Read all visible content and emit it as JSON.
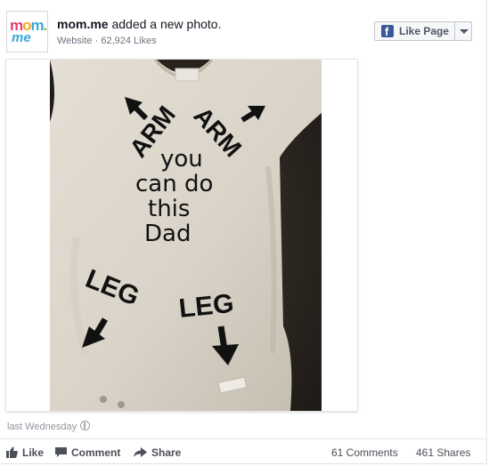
{
  "post": {
    "page_name": "mom.me",
    "action_text": " added a new photo.",
    "category": "Website",
    "likes": "62,924 Likes",
    "timestamp": "last Wednesday"
  },
  "logo": {
    "line1": [
      "m",
      "o",
      "m",
      "."
    ],
    "line2": "me"
  },
  "like_page_button": {
    "label": "Like Page"
  },
  "photo": {
    "arm_left": "ARM",
    "arm_right": "ARM",
    "line1": "you",
    "line2": "can do",
    "line3": "this",
    "line4": "Dad",
    "leg_left": "LEG",
    "leg_right": "LEG"
  },
  "actions": {
    "like": "Like",
    "comment": "Comment",
    "share": "Share"
  },
  "stats": {
    "comments": "61 Comments",
    "shares": "461 Shares"
  },
  "colors": {
    "fb_blue": "#3b5998",
    "logo_pink": "#e63b7a",
    "logo_orange": "#f6a623",
    "logo_blue": "#3aa7d9",
    "logo_green": "#7cc04b"
  }
}
